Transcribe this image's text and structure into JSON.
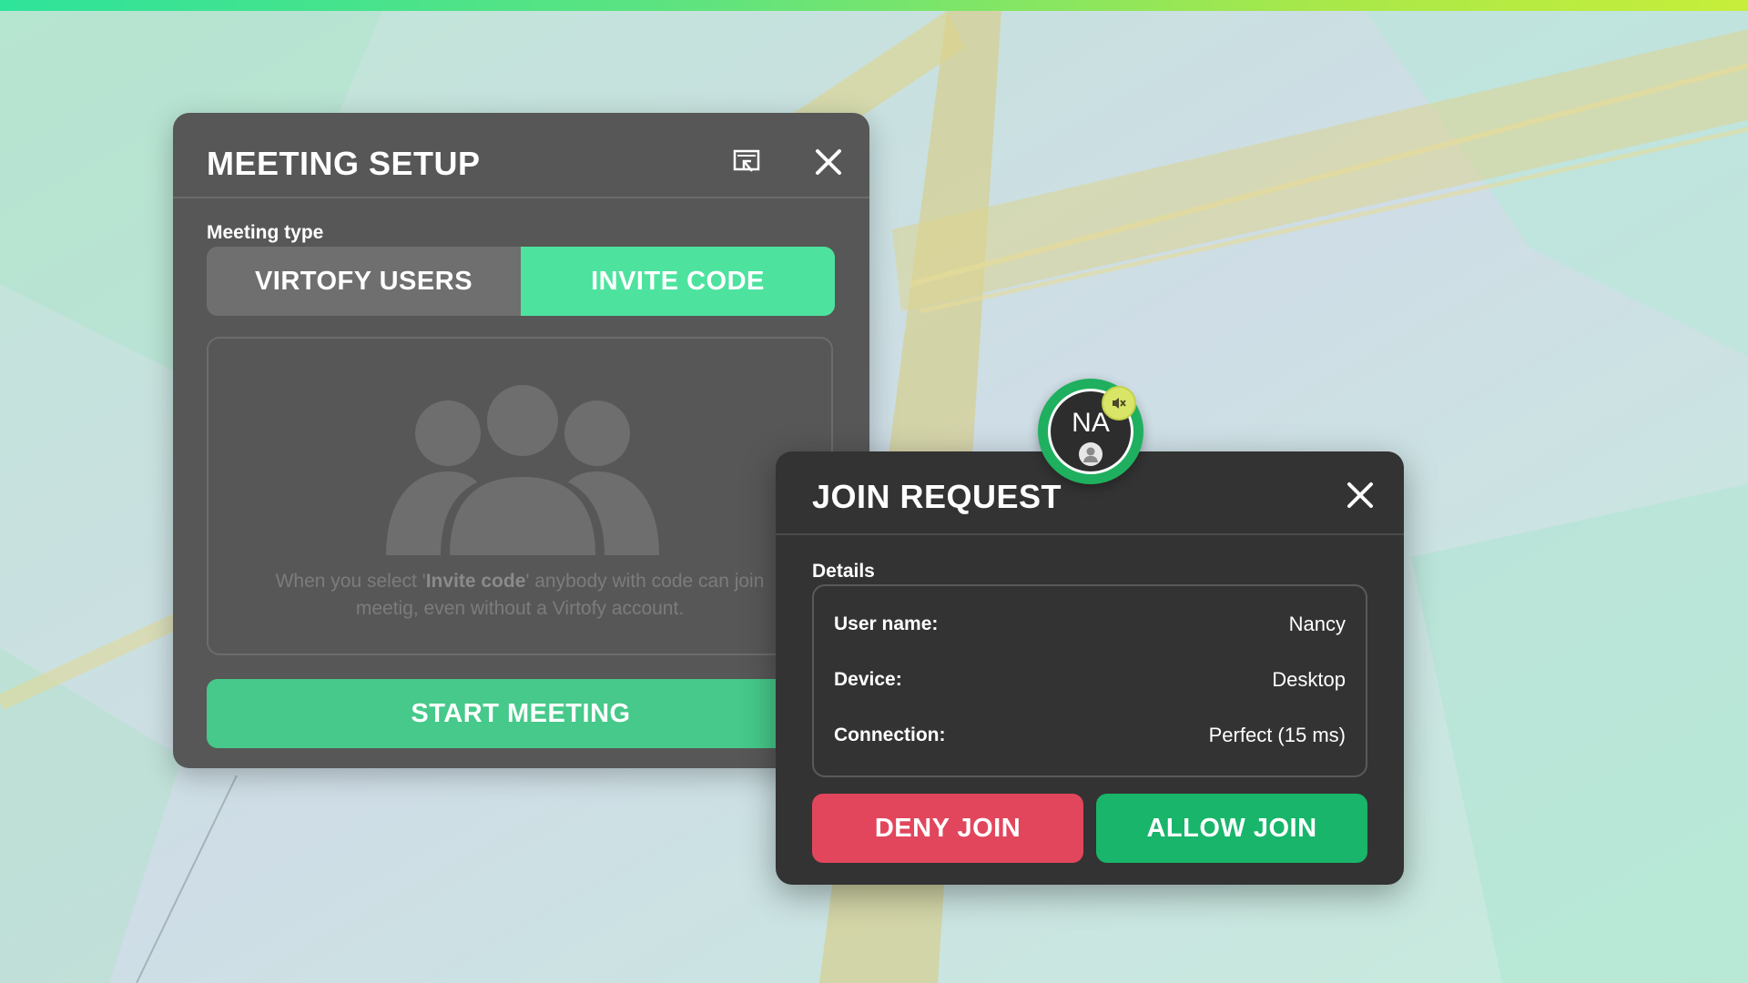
{
  "meeting_setup": {
    "title": "MEETING SETUP",
    "meeting_type_label": "Meeting type",
    "options": [
      "VIRTOFY USERS",
      "INVITE CODE"
    ],
    "selected": "INVITE CODE",
    "info_prefix": "When you select '",
    "info_bold": "Invite code",
    "info_suffix": "' anybody with code can join",
    "info_line2": "meetig, even without a Virtofy account.",
    "start_label": "START MEETING",
    "icons": [
      "popout-icon",
      "close-icon",
      "people-group-icon"
    ]
  },
  "join_request": {
    "title": "JOIN REQUEST",
    "details_label": "Details",
    "fields": [
      {
        "label": "User name:",
        "value": "Nancy"
      },
      {
        "label": "Device:",
        "value": "Desktop"
      },
      {
        "label": "Connection:",
        "value": "Perfect (15 ms)"
      }
    ],
    "deny_label": "DENY JOIN",
    "allow_label": "ALLOW JOIN",
    "avatar_initials": "NA",
    "icons": [
      "close-icon",
      "mute-icon",
      "person-icon"
    ]
  },
  "colors": {
    "accent_green": "#4de39f",
    "start_green": "#46c98a",
    "allow_green": "#18b56a",
    "deny_red": "#e2465d",
    "panel_gray": "#575757",
    "panel_dark": "#333333"
  }
}
